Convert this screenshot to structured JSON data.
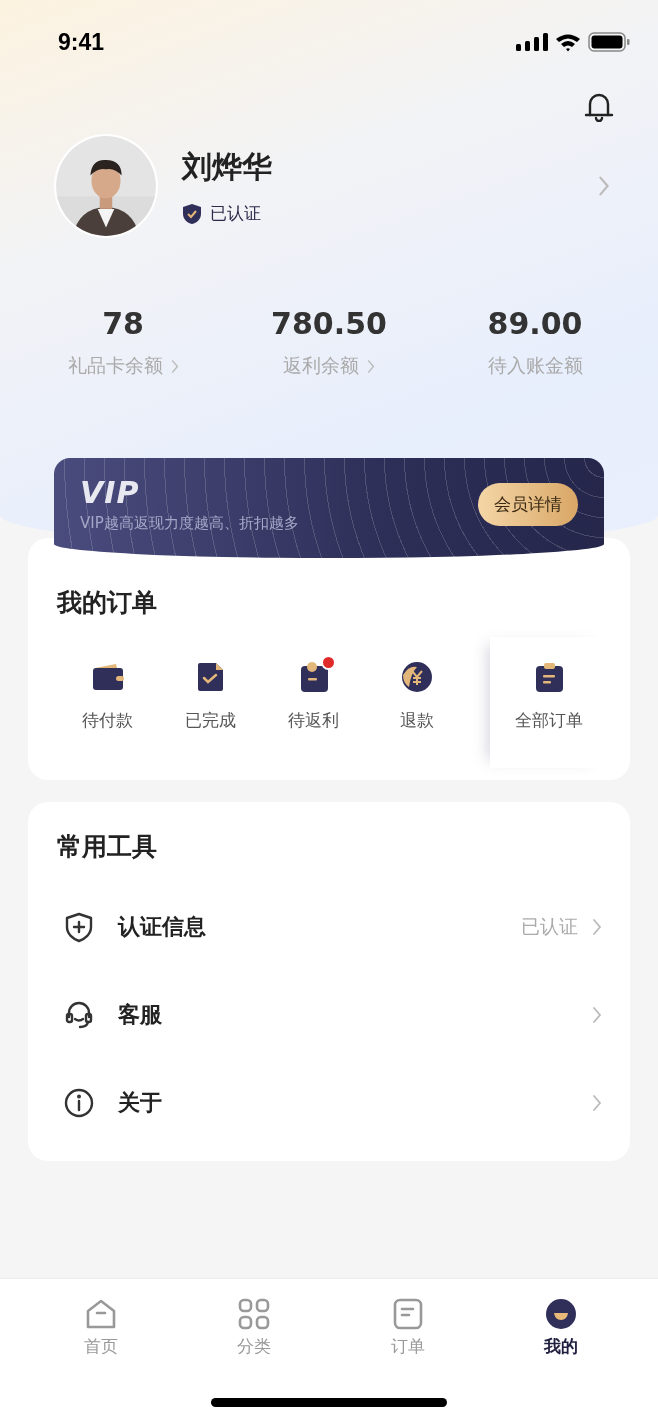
{
  "status_bar": {
    "time": "9:41"
  },
  "profile": {
    "name": "刘烨华",
    "verified_label": "已认证"
  },
  "stats": [
    {
      "value": "78",
      "label": "礼品卡余额",
      "has_arrow": true
    },
    {
      "value": "780.50",
      "label": "返利余额",
      "has_arrow": true
    },
    {
      "value": "89.00",
      "label": "待入账金额",
      "has_arrow": false
    }
  ],
  "vip": {
    "logo": "VIP",
    "slogan": "VIP越高返现力度越高、折扣越多",
    "button": "会员详情"
  },
  "orders": {
    "title": "我的订单",
    "items": [
      {
        "kind": "wallet",
        "label": "待付款",
        "badge": false
      },
      {
        "kind": "done",
        "label": "已完成",
        "badge": false
      },
      {
        "kind": "rebate",
        "label": "待返利",
        "badge": true
      },
      {
        "kind": "refund",
        "label": "退款",
        "badge": false
      }
    ],
    "all": {
      "kind": "all",
      "label": "全部订单"
    }
  },
  "tools": {
    "title": "常用工具",
    "items": [
      {
        "kind": "shield",
        "label": "认证信息",
        "value": "已认证"
      },
      {
        "kind": "service",
        "label": "客服"
      },
      {
        "kind": "info",
        "label": "关于"
      }
    ]
  },
  "tabs": [
    {
      "kind": "home",
      "label": "首页",
      "selected": false
    },
    {
      "kind": "grid",
      "label": "分类",
      "selected": false
    },
    {
      "kind": "list",
      "label": "订单",
      "selected": false
    },
    {
      "kind": "me",
      "label": "我的",
      "selected": true
    }
  ]
}
